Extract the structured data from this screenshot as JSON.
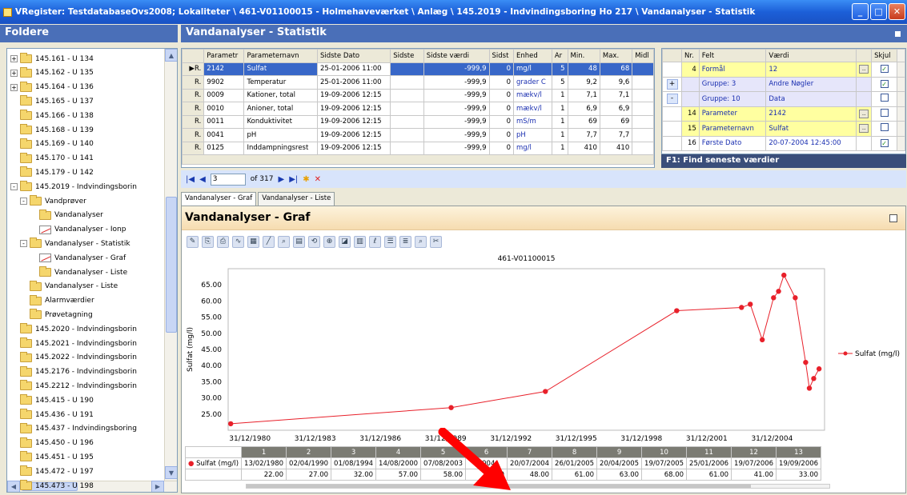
{
  "window": {
    "title": "VRegister: TestdatabaseOvs2008; Lokaliteter \\ 461-V01100015 - Holmehaveværket \\ Anlæg \\ 145.2019 - Indvindingsboring Ho 217 \\ Vandanalyser - Statistik",
    "min": "_",
    "max": "□",
    "close": "✕"
  },
  "left": {
    "header": "Foldere",
    "tree": [
      {
        "label": "145.161 - U 134",
        "indent": 0,
        "exp": "+",
        "icon": "folder"
      },
      {
        "label": "145.162 - U 135",
        "indent": 0,
        "exp": "+",
        "icon": "folder"
      },
      {
        "label": "145.164 - U 136",
        "indent": 0,
        "exp": "+",
        "icon": "folder"
      },
      {
        "label": "145.165 - U 137",
        "indent": 0,
        "exp": "",
        "icon": "folder"
      },
      {
        "label": "145.166 - U 138",
        "indent": 0,
        "exp": "",
        "icon": "folder"
      },
      {
        "label": "145.168 - U 139",
        "indent": 0,
        "exp": "",
        "icon": "folder"
      },
      {
        "label": "145.169 - U 140",
        "indent": 0,
        "exp": "",
        "icon": "folder"
      },
      {
        "label": "145.170 - U 141",
        "indent": 0,
        "exp": "",
        "icon": "folder"
      },
      {
        "label": "145.179 - U 142",
        "indent": 0,
        "exp": "",
        "icon": "folder"
      },
      {
        "label": "145.2019 - Indvindingsborin",
        "indent": 0,
        "exp": "-",
        "icon": "folder"
      },
      {
        "label": "Vandprøver",
        "indent": 1,
        "exp": "-",
        "icon": "folder"
      },
      {
        "label": "Vandanalyser",
        "indent": 2,
        "exp": "",
        "icon": "folder"
      },
      {
        "label": "Vandanalyser - Ionp",
        "indent": 2,
        "exp": "",
        "icon": "graph"
      },
      {
        "label": "Vandanalyser - Statistik",
        "indent": 1,
        "exp": "-",
        "icon": "folder"
      },
      {
        "label": "Vandanalyser - Graf",
        "indent": 2,
        "exp": "",
        "icon": "graph"
      },
      {
        "label": "Vandanalyser - Liste",
        "indent": 2,
        "exp": "",
        "icon": "folder"
      },
      {
        "label": "Vandanalyser - Liste",
        "indent": 1,
        "exp": "",
        "icon": "folder"
      },
      {
        "label": "Alarmværdier",
        "indent": 1,
        "exp": "",
        "icon": "folder"
      },
      {
        "label": "Prøvetagning",
        "indent": 1,
        "exp": "",
        "icon": "folder"
      },
      {
        "label": "145.2020 - Indvindingsborin",
        "indent": 0,
        "exp": "",
        "icon": "folder"
      },
      {
        "label": "145.2021 - Indvindingsborin",
        "indent": 0,
        "exp": "",
        "icon": "folder"
      },
      {
        "label": "145.2022 - Indvindingsborin",
        "indent": 0,
        "exp": "",
        "icon": "folder"
      },
      {
        "label": "145.2176 - Indvindingsborin",
        "indent": 0,
        "exp": "",
        "icon": "folder"
      },
      {
        "label": "145.2212 - Indvindingsborin",
        "indent": 0,
        "exp": "",
        "icon": "folder"
      },
      {
        "label": "145.415 - U 190",
        "indent": 0,
        "exp": "",
        "icon": "folder"
      },
      {
        "label": "145.436 - U 191",
        "indent": 0,
        "exp": "",
        "icon": "folder"
      },
      {
        "label": "145.437 - Indvindingsboring",
        "indent": 0,
        "exp": "",
        "icon": "folder"
      },
      {
        "label": "145.450 - U 196",
        "indent": 0,
        "exp": "",
        "icon": "folder"
      },
      {
        "label": "145.451 - U 195",
        "indent": 0,
        "exp": "",
        "icon": "folder"
      },
      {
        "label": "145.472 - U 197",
        "indent": 0,
        "exp": "",
        "icon": "folder"
      },
      {
        "label": "145.473 - U 198",
        "indent": 0,
        "exp": "",
        "icon": "folder"
      }
    ]
  },
  "main": {
    "header": "Vandanalyser - Statistik"
  },
  "grid": {
    "columns": [
      "Parametr",
      "Parameternavn",
      "Sidste Dato",
      "Sidste",
      "Sidste værdi",
      "Sidst",
      "Enhed",
      "Ar",
      "Min.",
      "Max.",
      "Midl"
    ],
    "rows": [
      [
        "2142",
        "Sulfat",
        "25-01-2006 11:00",
        "",
        "-999,9",
        "0",
        "mg/l",
        "5",
        "48",
        "68",
        ""
      ],
      [
        "9902",
        "Temperatur",
        "25-01-2006 11:00",
        "",
        "-999,9",
        "0",
        "grader C",
        "5",
        "9,2",
        "9,6",
        ""
      ],
      [
        "0009",
        "Kationer, total",
        "19-09-2006 12:15",
        "",
        "-999,9",
        "0",
        "mækv/l",
        "1",
        "7,1",
        "7,1",
        ""
      ],
      [
        "0010",
        "Anioner, total",
        "19-09-2006 12:15",
        "",
        "-999,9",
        "0",
        "mækv/l",
        "1",
        "6,9",
        "6,9",
        ""
      ],
      [
        "0011",
        "Konduktivitet",
        "19-09-2006 12:15",
        "",
        "-999,9",
        "0",
        "mS/m",
        "1",
        "69",
        "69",
        ""
      ],
      [
        "0041",
        "pH",
        "19-09-2006 12:15",
        "",
        "-999,9",
        "0",
        "pH",
        "1",
        "7,7",
        "7,7",
        ""
      ],
      [
        "0125",
        "Inddampningsrest",
        "19-09-2006 12:15",
        "",
        "-999,9",
        "0",
        "mg/l",
        "1",
        "410",
        "410",
        ""
      ]
    ],
    "rowmarker": "R.",
    "current": "▶"
  },
  "props": {
    "columns": [
      "Nr.",
      "Felt",
      "Værdi",
      "Skjul"
    ],
    "rows": [
      {
        "btn": "",
        "nr": "4",
        "felt": "Formål",
        "vaerdi": "12",
        "dots": true,
        "checked": true,
        "style": "y"
      },
      {
        "btn": "+",
        "nr": "",
        "felt": "Gruppe: 3",
        "vaerdi": "Andre Nøgler",
        "dots": false,
        "checked": true,
        "style": "l"
      },
      {
        "btn": "-",
        "nr": "",
        "felt": "Gruppe: 10",
        "vaerdi": "Data",
        "dots": false,
        "checked": false,
        "style": "l"
      },
      {
        "btn": "",
        "nr": "14",
        "felt": "Parameter",
        "vaerdi": "2142",
        "dots": true,
        "checked": false,
        "style": "y"
      },
      {
        "btn": "",
        "nr": "15",
        "felt": "Parameternavn",
        "vaerdi": "Sulfat",
        "dots": true,
        "checked": false,
        "style": "y"
      },
      {
        "btn": "",
        "nr": "16",
        "felt": "Første Dato",
        "vaerdi": "20-07-2004 12:45:00",
        "dots": false,
        "checked": true,
        "style": ""
      }
    ],
    "footer": "F1: Find seneste værdier"
  },
  "nav": {
    "record": "3",
    "of": "of 317"
  },
  "tabs": {
    "graf": "Vandanalyser - Graf",
    "liste": "Vandanalyser - Liste"
  },
  "graph": {
    "header": "Vandanalyser - Graf"
  },
  "chart_data": {
    "type": "line",
    "title": "461-V01100015",
    "ylabel": "Sulfat (mg/l)",
    "xlabel": "",
    "ylim": [
      20,
      70
    ],
    "yticks": [
      "25.00",
      "30.00",
      "35.00",
      "40.00",
      "45.00",
      "50.00",
      "55.00",
      "60.00",
      "65.00"
    ],
    "xticks": [
      "31/12/1980",
      "31/12/1983",
      "31/12/1986",
      "31/12/1989",
      "31/12/1992",
      "31/12/1995",
      "31/12/1998",
      "31/12/2001",
      "31/12/2004"
    ],
    "legend": "right",
    "color": "#e8202a",
    "series": [
      {
        "name": "Sulfat (mg/l)",
        "points": [
          [
            "1980-02-13",
            22
          ],
          [
            "1990-04-02",
            27
          ],
          [
            "1994-08-01",
            32
          ],
          [
            "2000-08-14",
            57
          ],
          [
            "2003-08-07",
            58
          ],
          [
            "2004-01-01",
            59
          ],
          [
            "2004-07-20",
            48
          ],
          [
            "2005-01-26",
            61
          ],
          [
            "2005-04-20",
            63
          ],
          [
            "2005-07-19",
            68
          ],
          [
            "2006-01-25",
            61
          ],
          [
            "2006-07-19",
            41
          ],
          [
            "2006-09-19",
            33
          ],
          [
            "2006-12-01",
            36
          ],
          [
            "2007-03-01",
            39
          ]
        ]
      }
    ]
  },
  "datatable": {
    "label": "Sulfat (mg/l)",
    "index": [
      "1",
      "2",
      "3",
      "4",
      "5",
      "6",
      "7",
      "8",
      "9",
      "10",
      "11",
      "12",
      "13"
    ],
    "dates": [
      "13/02/1980",
      "02/04/1990",
      "01/08/1994",
      "14/08/2000",
      "07/08/2003",
      "2004",
      "20/07/2004",
      "26/01/2005",
      "20/04/2005",
      "19/07/2005",
      "25/01/2006",
      "19/07/2006",
      "19/09/2006"
    ],
    "values": [
      "22.00",
      "27.00",
      "32.00",
      "57.00",
      "58.00",
      ".00",
      "48.00",
      "61.00",
      "63.00",
      "68.00",
      "61.00",
      "41.00",
      "33.00"
    ]
  }
}
